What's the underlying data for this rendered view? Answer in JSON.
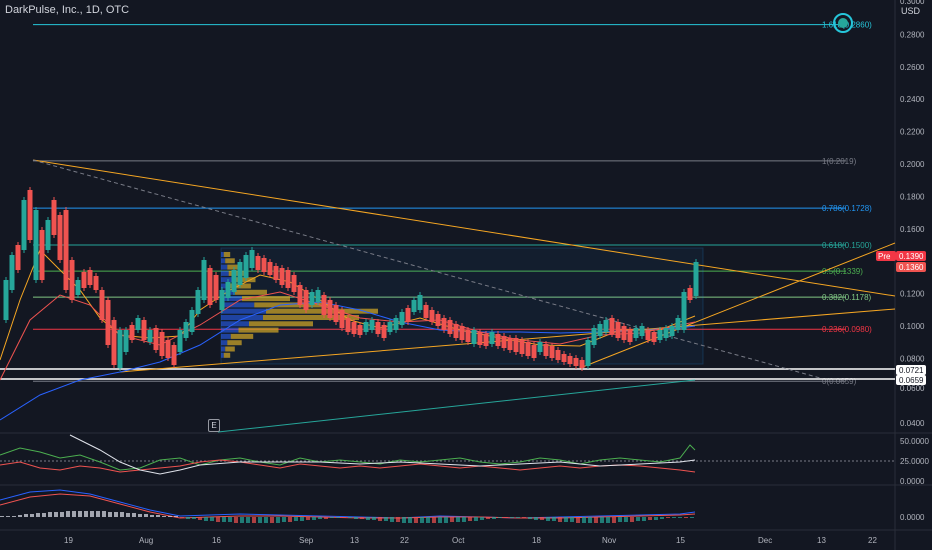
{
  "header": {
    "symbol": "DarkPulse, Inc., 1D, OTC",
    "currency": "USD"
  },
  "price_axis": {
    "ticks": [
      "0.2800",
      "0.2600",
      "0.2400",
      "0.2200",
      "0.2000",
      "0.1800",
      "0.1600",
      "0.1200",
      "0.1000",
      "0.0800",
      "0.0400"
    ],
    "top_tick": "0.3000",
    "badges": {
      "pre_label": "Pre",
      "pre_price": "0.1390",
      "last_price": "0.1360",
      "support_a": "0.0721",
      "support_b": "0.0659",
      "support_c": "0.0600"
    }
  },
  "time_axis": {
    "labels": [
      "19",
      "Aug",
      "16",
      "Sep",
      "13",
      "22",
      "Oct",
      "18",
      "Nov",
      "15",
      "Dec",
      "13",
      "22"
    ]
  },
  "fib_levels": [
    {
      "label": "1.618(0.2860)",
      "color": "#26c6da"
    },
    {
      "label": "1(0.2019)",
      "color": "#787b86"
    },
    {
      "label": "0.786(0.1728)",
      "color": "#2196f3"
    },
    {
      "label": "0.618(0.1500)",
      "color": "#26a69a"
    },
    {
      "label": "0.5(0.1339)",
      "color": "#4caf50"
    },
    {
      "label": "0.382(0.1178)",
      "color": "#81c784"
    },
    {
      "label": "0.236(0.0980)",
      "color": "#f23645"
    },
    {
      "label": "0(0.0659)",
      "color": "#787b86"
    }
  ],
  "indicators": {
    "rsi_ticks": [
      "50.0000",
      "25.0000",
      "0.0000"
    ],
    "macd_ticks": [
      "0.0000"
    ]
  },
  "earnings_marker": "E",
  "colors": {
    "background": "#131722",
    "up": "#26a69a",
    "down": "#ef5350",
    "trendline": "#f5a623"
  }
}
